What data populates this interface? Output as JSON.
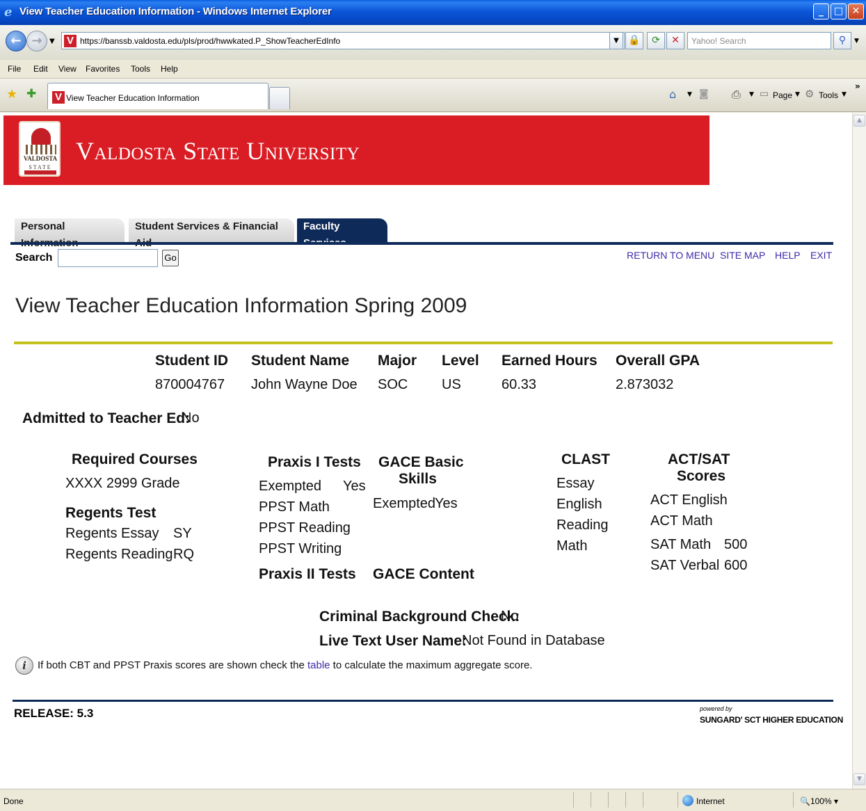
{
  "window": {
    "title": "View Teacher Education Information - Windows Internet Explorer",
    "minimize": "_",
    "maximize": "□",
    "close": "✕"
  },
  "address_bar": {
    "url": "https://banssb.valdosta.edu/pls/prod/hwwkated.P_ShowTeacherEdInfo",
    "search_placeholder": "Yahoo! Search"
  },
  "menu": [
    "File",
    "Edit",
    "View",
    "Favorites",
    "Tools",
    "Help"
  ],
  "tabs": {
    "active_label": "View Teacher Education Information"
  },
  "toolbar": {
    "page": "Page",
    "tools": "Tools"
  },
  "banner": {
    "university": "Valdosta State University",
    "seal_name": "VALDOSTA",
    "seal_state": "STATE"
  },
  "nav_tabs": [
    "Personal Information",
    "Student Services & Financial Aid",
    "Faculty Services"
  ],
  "search": {
    "label": "Search",
    "go": "Go"
  },
  "top_links": [
    "RETURN TO MENU",
    "SITE MAP",
    "HELP",
    "EXIT"
  ],
  "page_title": "View Teacher Education Information Spring 2009",
  "student": {
    "headers": [
      "Student ID",
      "Student Name",
      "Major",
      "Level",
      "Earned Hours",
      "Overall GPA"
    ],
    "values": [
      "870004767",
      "John Wayne Doe",
      "SOC",
      "US",
      "60.33",
      "2.873032"
    ]
  },
  "admitted": {
    "label": "Admitted to Teacher Ed:",
    "value": "No"
  },
  "required_courses": {
    "heading": "Required Courses",
    "course": "XXXX 2999 Grade",
    "regents_heading": "Regents Test",
    "regents_essay": "Regents Essay",
    "regents_essay_val": "SY",
    "regents_reading": "Regents Reading",
    "regents_reading_val": "RQ"
  },
  "praxis1": {
    "heading": "Praxis I Tests",
    "exempted": "Exempted",
    "exempted_val": "Yes",
    "math": "PPST Math",
    "reading": "PPST Reading",
    "writing": "PPST Writing"
  },
  "praxis2": {
    "heading": "Praxis II Tests"
  },
  "gace_basic": {
    "heading_1": "GACE Basic",
    "heading_2": "Skills",
    "exempted": "Exempted",
    "exempted_val": "Yes"
  },
  "gace_content": {
    "heading": "GACE Content"
  },
  "clast": {
    "heading": "CLAST",
    "items": [
      "Essay",
      "English",
      "Reading",
      "Math"
    ]
  },
  "act_sat": {
    "heading_1": "ACT/SAT",
    "heading_2": "Scores",
    "act_english": "ACT English",
    "act_math": "ACT Math",
    "sat_math": "SAT Math",
    "sat_math_val": "500",
    "sat_verbal": "SAT Verbal",
    "sat_verbal_val": "600"
  },
  "background": {
    "label": "Criminal Background Check:",
    "value": "No"
  },
  "livetext": {
    "label": "Live Text User Name:",
    "value": "Not Found in Database"
  },
  "info": {
    "before": "If both CBT and PPST Praxis scores are shown check the ",
    "link": "table",
    "after": " to calculate the maximum aggregate score."
  },
  "footer": {
    "release": "RELEASE: 5.3",
    "powered": "powered by",
    "sungard": "SUNGARD' SCT HIGHER EDUCATION"
  },
  "status": {
    "left": "Done",
    "zone": "Internet",
    "zoom": "100%"
  }
}
